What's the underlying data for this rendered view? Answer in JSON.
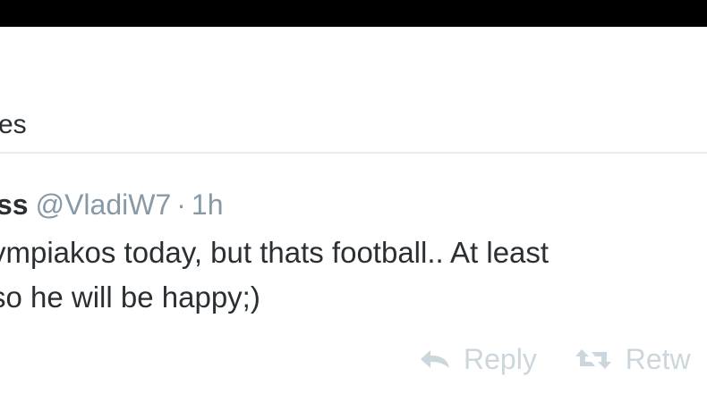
{
  "header": {
    "label": "es"
  },
  "tweet": {
    "fullname": "ss",
    "username": "@VladiW7",
    "separator": "·",
    "time": "1h",
    "text_lines": [
      "ympiakos today, but thats football.. At least",
      " so he will be happy;)"
    ]
  },
  "actions": {
    "reply_label": "Reply",
    "reply_icon": "reply-icon",
    "retweet_label": "Retw",
    "retweet_icon": "retweet-icon"
  },
  "colors": {
    "top_bar": "#000000",
    "text": "#292f33",
    "muted": "#8899a6",
    "action": "#ccd6dd",
    "divider": "#e6ecf0"
  }
}
